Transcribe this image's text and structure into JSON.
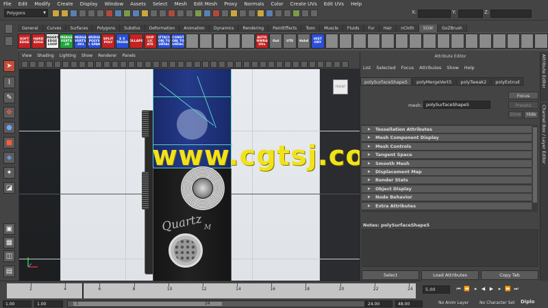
{
  "menubar": [
    "File",
    "Edit",
    "Modify",
    "Create",
    "Display",
    "Window",
    "Assets",
    "Select",
    "Mesh",
    "Edit Mesh",
    "Proxy",
    "Normals",
    "Color",
    "Create UVs",
    "Edit UVs",
    "Help"
  ],
  "status": {
    "mode": "Polygons",
    "x_label": "X:",
    "y_label": "Y:",
    "z_label": "Z:"
  },
  "shelf_tabs": [
    "General",
    "Curves",
    "Surfaces",
    "Polygons",
    "Subdivs",
    "Deformation",
    "Animation",
    "Dynamics",
    "Rendering",
    "PaintEffects",
    "Toon",
    "Muscle",
    "Fluids",
    "Fur",
    "Hair",
    "nCloth",
    "SGW",
    "GoZBrush"
  ],
  "shelf_active_tab": "SGW",
  "shelf_buttons": [
    {
      "text": "SOFT EDGE",
      "color": "red"
    },
    {
      "text": "HARD EDGE",
      "color": "red"
    },
    {
      "text": "INSERT EDGE LOOP",
      "color": "white"
    },
    {
      "text": "MERGE VERTS .10",
      "color": "green"
    },
    {
      "text": "MERGE VERTS .001",
      "color": "blue"
    },
    {
      "text": "BRIDGE POLYS 1 SPAN",
      "color": "blue"
    },
    {
      "text": "SPLIT POLY",
      "color": "red"
    },
    {
      "text": "E X TRUDE",
      "color": "blue"
    },
    {
      "text": "COLLAPSE",
      "color": "red"
    },
    {
      "text": "DUP LIC ATE",
      "color": "red"
    },
    {
      "text": "ATTACH OBJ TO SURFACE",
      "color": "blue"
    },
    {
      "text": "CONST OBJ TO SURFACE",
      "color": "blue"
    },
    {
      "text": "",
      "color": "icon"
    },
    {
      "text": "",
      "color": "icon"
    },
    {
      "text": "",
      "color": "icon"
    },
    {
      "text": "",
      "color": "icon"
    },
    {
      "text": "",
      "color": "icon"
    },
    {
      "text": "AUTO UNWRAP UVs",
      "color": "red"
    },
    {
      "text": "Out",
      "color": "gray"
    },
    {
      "text": "UTE",
      "color": "gray"
    },
    {
      "text": "Hshd",
      "color": "gray"
    },
    {
      "text": "HIST ORY",
      "color": "blue"
    },
    {
      "text": "",
      "color": "icon"
    },
    {
      "text": "",
      "color": "icon"
    },
    {
      "text": "",
      "color": "icon"
    },
    {
      "text": "",
      "color": "icon"
    },
    {
      "text": "",
      "color": "icon"
    },
    {
      "text": "",
      "color": "icon"
    },
    {
      "text": "",
      "color": "icon"
    },
    {
      "text": "",
      "color": "icon"
    },
    {
      "text": "",
      "color": "icon"
    },
    {
      "text": "",
      "color": "icon"
    },
    {
      "text": "",
      "color": "icon"
    },
    {
      "text": "",
      "color": "icon"
    },
    {
      "text": "",
      "color": "icon"
    },
    {
      "text": "",
      "color": "icon"
    },
    {
      "text": "",
      "color": "icon"
    },
    {
      "text": "",
      "color": "icon"
    }
  ],
  "viewport": {
    "menu": [
      "View",
      "Shading",
      "Lighting",
      "Show",
      "Renderer",
      "Panels"
    ],
    "cube_label": "FRONT",
    "model_text": "Quartz",
    "model_subtext": "M"
  },
  "watermark": "www.cgtsj.com",
  "attribute_editor": {
    "title": "Attribute Editor",
    "menu": [
      "List",
      "Selected",
      "Focus",
      "Attributes",
      "Show",
      "Help"
    ],
    "tabs": [
      "polySurfaceShape5",
      "polyMergeVert5",
      "polyTweak2",
      "polyExtrud"
    ],
    "active_tab": "polySurfaceShape5",
    "focus_label": "Focus",
    "presets_label": "Presets",
    "show_label": "Show",
    "hide_label": "Hide",
    "mesh_label": "mesh:",
    "mesh_value": "polySurfaceShape5",
    "sections": [
      "Tessellation Attributes",
      "Mesh Component Display",
      "Mesh Controls",
      "Tangent Space",
      "Smooth Mesh",
      "Displacement Map",
      "Render Stats",
      "Object Display",
      "Node Behavior",
      "Extra Attributes"
    ],
    "notes_label": "Notes:  polySurfaceShape5",
    "buttons": {
      "select": "Select",
      "load": "Load Attributes",
      "copy": "Copy Tab"
    }
  },
  "side_tabs": [
    "Attribute Editor",
    "Channel Box / Layer Editor"
  ],
  "timeline": {
    "ticks": [
      "2",
      "4",
      "6",
      "8",
      "10",
      "12",
      "14",
      "16",
      "18",
      "20",
      "22",
      "24"
    ],
    "current_frame": "5.00"
  },
  "range": {
    "start": "1.00",
    "playback_start": "1.00",
    "range_start_marker": "1",
    "range_end_marker": "24",
    "playback_end": "24.00",
    "end": "48.00",
    "anim_layer": "No Anim Layer",
    "character_set": "No Character Set",
    "logo": "Diplo"
  },
  "colors": {
    "accent_active_tool": "#c44c3a",
    "wireframe": "#5ad0c8",
    "watermark": "#f2e21a"
  }
}
